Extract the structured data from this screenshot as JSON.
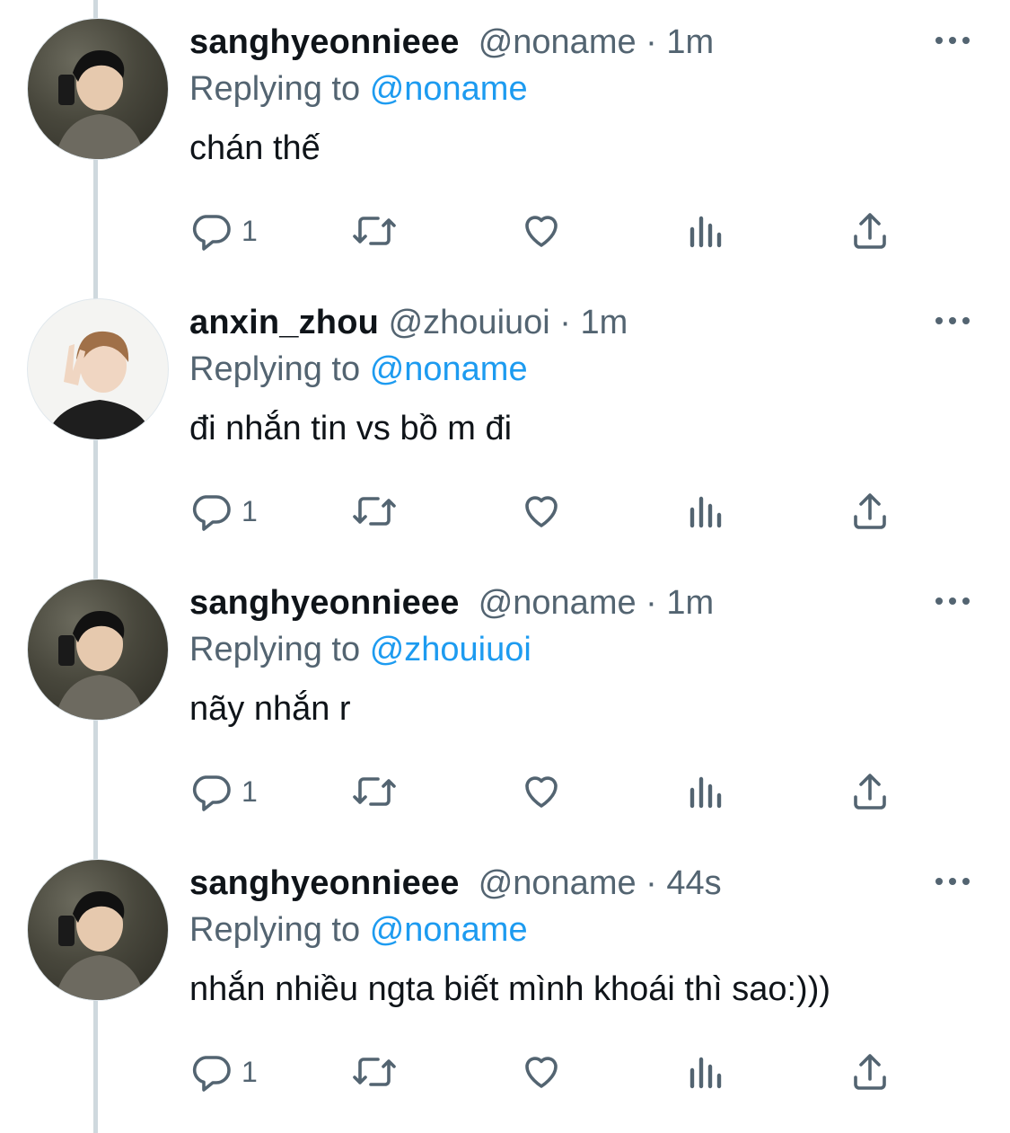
{
  "colors": {
    "accent": "#1d9bf0",
    "muted": "#536471",
    "text": "#0f1419",
    "thread": "#cfd9de"
  },
  "icons": [
    "reply-icon",
    "retweet-icon",
    "like-icon",
    "views-icon",
    "share-icon",
    "more-icon"
  ],
  "tweets": [
    {
      "name": "sanghyeonnieee",
      "handle": "@noname",
      "sep": "·",
      "time": "1m",
      "reply_prefix": "Replying to",
      "reply_to": "@noname",
      "text": "chán thế",
      "reply_count": "1",
      "avatar": "dark"
    },
    {
      "name": "anxin_zhou",
      "handle": "@zhouiuoi",
      "sep": "·",
      "time": "1m",
      "reply_prefix": "Replying to",
      "reply_to": "@noname",
      "text": "đi nhắn tin vs bồ m đi",
      "reply_count": "1",
      "avatar": "light"
    },
    {
      "name": "sanghyeonnieee",
      "handle": "@noname",
      "sep": "·",
      "time": "1m",
      "reply_prefix": "Replying to",
      "reply_to": "@zhouiuoi",
      "text": "nãy nhắn r",
      "reply_count": "1",
      "avatar": "dark"
    },
    {
      "name": "sanghyeonnieee",
      "handle": "@noname",
      "sep": "·",
      "time": "44s",
      "reply_prefix": "Replying to",
      "reply_to": "@noname",
      "text": "nhắn nhiều ngta biết mình khoái thì sao:)))",
      "reply_count": "1",
      "avatar": "dark"
    }
  ]
}
